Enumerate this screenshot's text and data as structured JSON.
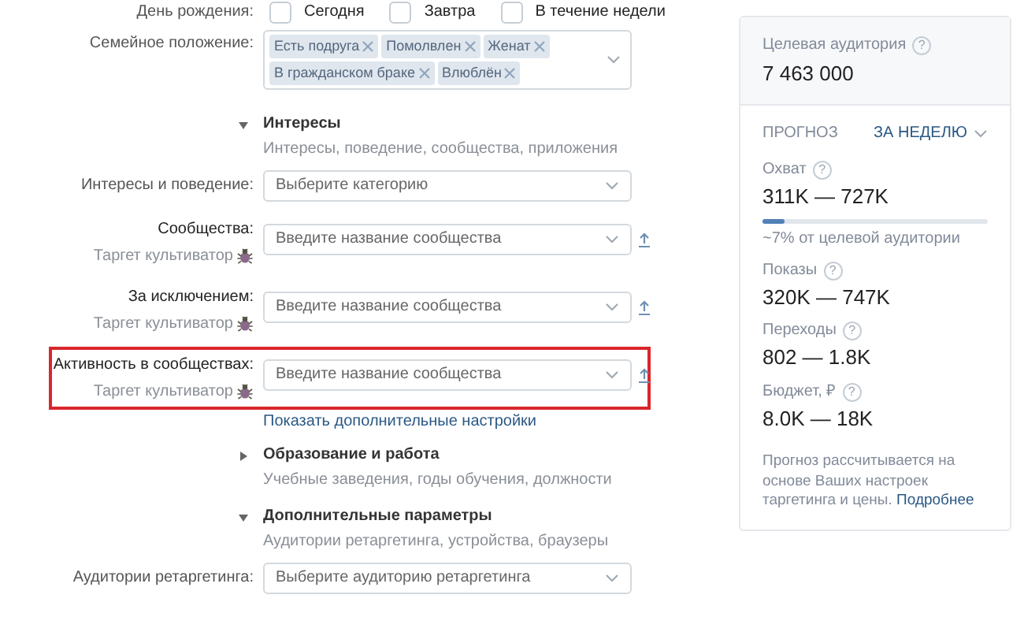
{
  "birthday": {
    "label": "День рождения:",
    "options": [
      {
        "label": "Сегодня",
        "checked": false
      },
      {
        "label": "Завтра",
        "checked": false
      },
      {
        "label": "В течение недели",
        "checked": false
      }
    ]
  },
  "family_status": {
    "label": "Семейное положение:",
    "tags": [
      "Есть подруга",
      "Помолвлен",
      "Женат",
      "В гражданском браке",
      "Влюблён"
    ]
  },
  "form": [
    {
      "kind": "section",
      "title": "Интересы",
      "subtitle": "Интересы, поведение, сообщества, приложения",
      "expanded": true
    },
    {
      "kind": "select",
      "label": "Интересы и поведение:",
      "placeholder": "Выберите категорию"
    },
    {
      "kind": "community",
      "label": "Сообщества:",
      "sublabel": "Таргет культиватор",
      "placeholder": "Введите название сообщества",
      "highlighted": false
    },
    {
      "kind": "community",
      "label": "За исключением:",
      "sublabel": "Таргет культиватор",
      "placeholder": "Введите название сообщества",
      "highlighted": false
    },
    {
      "kind": "community",
      "label": "Активность в сообществах:",
      "sublabel": "Таргет культиватор",
      "placeholder": "Введите название сообщества",
      "highlighted": true
    },
    {
      "kind": "link",
      "text": "Показать дополнительные настройки"
    },
    {
      "kind": "section",
      "title": "Образование и работа",
      "subtitle": "Учебные заведения, годы обучения, должности",
      "expanded": false
    },
    {
      "kind": "section",
      "title": "Дополнительные параметры",
      "subtitle": "Аудитории ретаргетинга, устройства, браузеры",
      "expanded": true
    },
    {
      "kind": "select",
      "label": "Аудитории ретаргетинга:",
      "placeholder": "Выберите аудиторию ретаргетинга"
    }
  ],
  "panel": {
    "audience": {
      "label": "Целевая аудитория",
      "help": "?",
      "value": "7 463 000"
    },
    "forecast_label": "ПРОГНОЗ",
    "period": "ЗА НЕДЕЛЮ",
    "metrics": [
      {
        "label": "Охват",
        "help": "?",
        "value": "311K — 727K",
        "level": 0.1,
        "note": "~7% от целевой аудитории"
      },
      {
        "label": "Показы",
        "help": "?",
        "value": "320K — 747K"
      },
      {
        "label": "Переходы",
        "help": "?",
        "value": "802 — 1.8K"
      },
      {
        "label": "Бюджет, ₽",
        "help": "?",
        "value": "8.0K — 18K"
      }
    ],
    "footnote": "Прогноз рассчитывается на основе Ваших настроек таргетинга и цены.",
    "footnote_link": "Подробнее"
  }
}
